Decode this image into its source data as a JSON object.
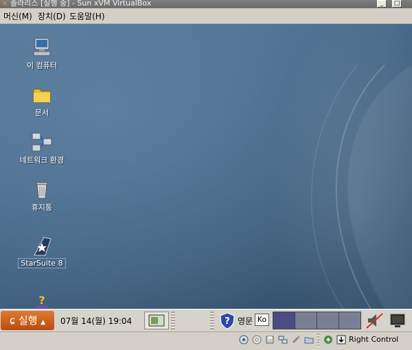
{
  "window": {
    "title": "솔라리스 [실행 중] - Sun xVM VirtualBox",
    "buttons": [
      "minimize",
      "maximize"
    ]
  },
  "menubar": {
    "items": [
      {
        "label": "머신(M)"
      },
      {
        "label": "장치(D)"
      },
      {
        "label": "도움말(H)"
      }
    ]
  },
  "desktop": {
    "icons": [
      {
        "label": "이 컴퓨터",
        "icon": "computer-icon"
      },
      {
        "label": "문서",
        "icon": "folder-icon"
      },
      {
        "label": "네트워크 환경",
        "icon": "network-icon"
      },
      {
        "label": "휴지통",
        "icon": "trash-icon"
      },
      {
        "label": "StarSuite 8",
        "icon": "starsuite-icon",
        "selected": true
      },
      {
        "label": "",
        "icon": "help-icon"
      }
    ]
  },
  "taskbar": {
    "start_label": "실행",
    "clock": "07월 14(월) 19:04",
    "language_label": "영문",
    "ime_label": "Ko",
    "workspaces": {
      "count": 4,
      "active": 1
    },
    "volume_muted": true
  },
  "statusbar": {
    "host_key": "Right Control"
  },
  "colors": {
    "desktop": "#40617f",
    "start_button": "#d0621f",
    "active_workspace": "#4a4c84"
  }
}
